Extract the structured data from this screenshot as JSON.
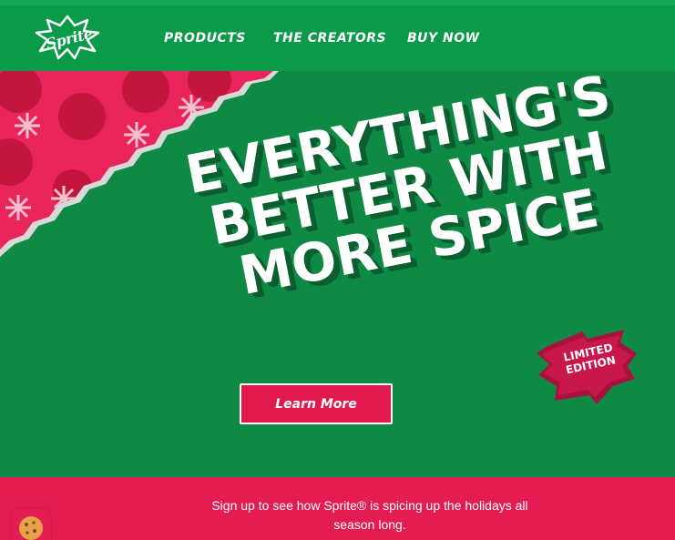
{
  "header": {
    "logo_text": "Sprite",
    "nav": [
      {
        "label": "PRODUCTS"
      },
      {
        "label": "THE CREATORS"
      },
      {
        "label": "BUY NOW"
      }
    ]
  },
  "hero": {
    "headline": [
      "EVERYTHING'S",
      "BETTER WITH",
      "MORE SPICE"
    ],
    "badge": [
      "LIMITED",
      "EDITION"
    ],
    "cta_label": "Learn More"
  },
  "signup": {
    "text": "Sign up to see how Sprite® is spicing up the holidays all season long."
  },
  "colors": {
    "green": "#0f8a45",
    "header_green": "#0a9a4a",
    "red": "#e31c52",
    "white": "#ffffff"
  },
  "icons": {
    "logo": "sprite-logo-icon",
    "cookie": "cookie-icon"
  }
}
